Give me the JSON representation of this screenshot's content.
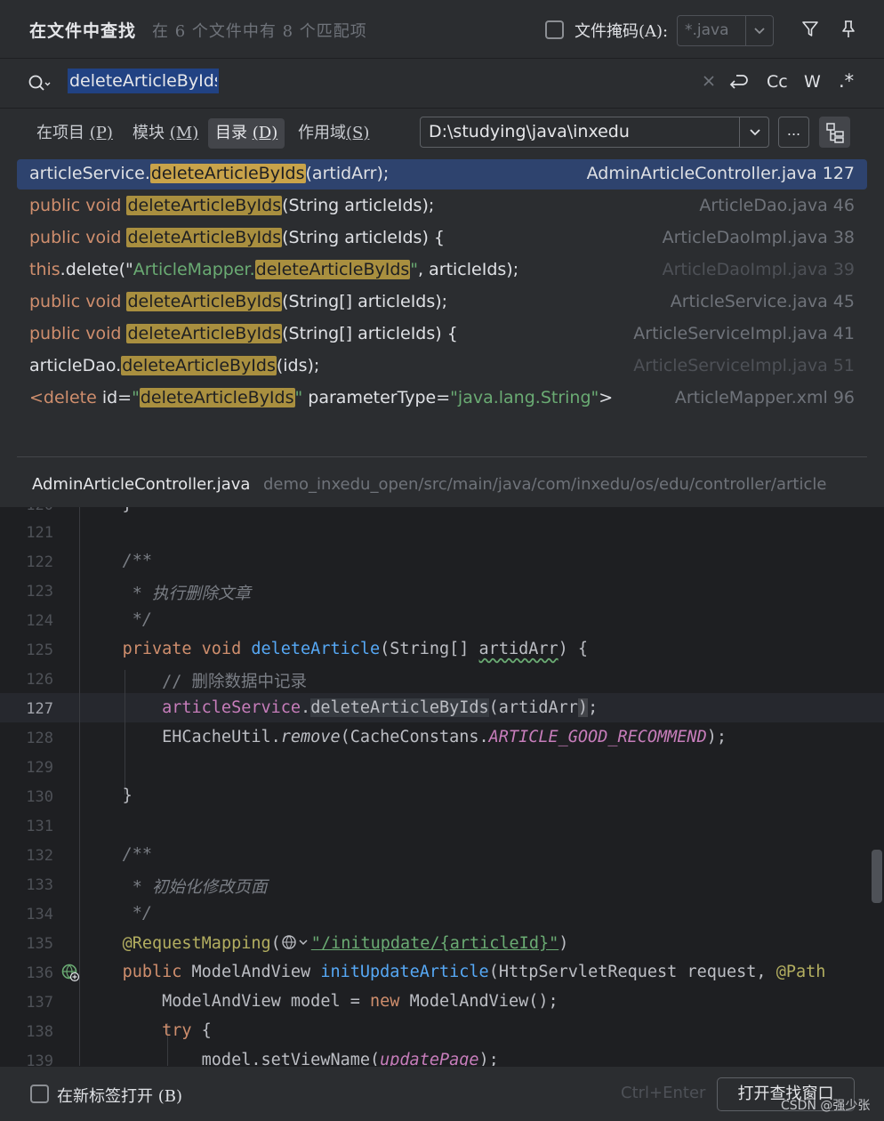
{
  "header": {
    "title": "在文件中查找",
    "subtitle": "在 6 个文件中有 8 个匹配项",
    "file_mask_label": "文件掩码(A):",
    "file_mask_value": "*.java"
  },
  "search": {
    "query": "deleteArticleByIds",
    "toggle_case": "Cc",
    "toggle_words": "W",
    "toggle_regex": ".*"
  },
  "scope": {
    "tabs": [
      {
        "label": "在项目",
        "key": "(P)"
      },
      {
        "label": "模块",
        "key": "(M)"
      },
      {
        "label": "目录",
        "key": "(D)"
      },
      {
        "label": "作用域",
        "key": "(S)"
      }
    ],
    "directory": "D:\\studying\\java\\inxedu",
    "browse_label": "..."
  },
  "results": [
    {
      "pre": "articleService.",
      "match": "deleteArticleByIds",
      "post": "(artidArr);",
      "file": "AdminArticleController.java 127"
    },
    {
      "pre_kw": "public void ",
      "match": "deleteArticleByIds",
      "post": "(String articleIds);",
      "file": "ArticleDao.java 46"
    },
    {
      "pre_kw": "public void ",
      "match": "deleteArticleByIds",
      "post": "(String articleIds) {",
      "file": "ArticleDaoImpl.java 38"
    },
    {
      "pre_kw": "this",
      "pre": ".delete(\"",
      "pre_str": "ArticleMapper.",
      "match": "deleteArticleByIds",
      "post_str": "\"",
      "post": ", articleIds);",
      "file": "ArticleDaoImpl.java 39"
    },
    {
      "pre_kw": "public void ",
      "match": "deleteArticleByIds",
      "post": "(String[] articleIds);",
      "file": "ArticleService.java 45"
    },
    {
      "pre_kw": "public void ",
      "match": "deleteArticleByIds",
      "post": "(String[] articleIds) {",
      "file": "ArticleServiceImpl.java 41"
    },
    {
      "pre": "articleDao.",
      "match": "deleteArticleByIds",
      "post": "(ids);",
      "file": "ArticleServiceImpl.java 51"
    },
    {
      "pre_kw": "<delete ",
      "pre": "id=",
      "pre_str": "\"",
      "match": "deleteArticleByIds",
      "post_str": "\"",
      "post": " parameterType=",
      "post_str2": "\"java.lang.String\"",
      "post2": ">",
      "file": "ArticleMapper.xml 96"
    }
  ],
  "preview": {
    "file_name": "AdminArticleController.java",
    "path": "demo_inxedu_open/src/main/java/com/inxedu/os/edu/controller/article",
    "line_numbers": [
      "121",
      "122",
      "123",
      "124",
      "125",
      "126",
      "127",
      "128",
      "129",
      "130",
      "131",
      "132",
      "133",
      "134",
      "135",
      "136",
      "137",
      "138",
      "139"
    ],
    "current_line": "127",
    "code": {
      "l122": "/**",
      "l123": " * 执行删除文章",
      "l124": " */",
      "l125_kw": "private void ",
      "l125_fn": "deleteArticle",
      "l125_a": "(String[] ",
      "l125_param": "artidArr",
      "l125_b": ") {",
      "l126": "// 删除数据中记录",
      "l127_field": "articleService",
      "l127_a": ".",
      "l127_m": "deleteArticleByIds",
      "l127_b": "(artidArr",
      "l127_c": ")",
      "l127_d": ";",
      "l128_a": "EHCacheUtil.",
      "l128_m": "remove",
      "l128_b": "(CacheConstans.",
      "l128_const": "ARTICLE_GOOD_RECOMMEND",
      "l128_c": ");",
      "l130": "}",
      "l132": "/**",
      "l133": " * 初始化修改页面",
      "l134": " */",
      "l135_ann": "@RequestMapping",
      "l135_a": "(",
      "l135_str": "\"/initupdate/{articleId}\"",
      "l135_b": ")",
      "l136_kw": "public ",
      "l136_a": "ModelAndView ",
      "l136_fn": "initUpdateArticle",
      "l136_b": "(HttpServletRequest request, ",
      "l136_ann": "@Path",
      "l137_a": "ModelAndView model = ",
      "l137_kw": "new ",
      "l137_b": "ModelAndView();",
      "l138_kw": "try ",
      "l138_a": "{",
      "l139_a": "model.setViewName(",
      "l139_it": "updatePage",
      "l139_b": ");"
    }
  },
  "footer": {
    "new_tab_label": "在新标签打开 (B)",
    "shortcut": "Ctrl+Enter",
    "open_button": "打开查找窗口",
    "watermark": "CSDN @强少张"
  }
}
